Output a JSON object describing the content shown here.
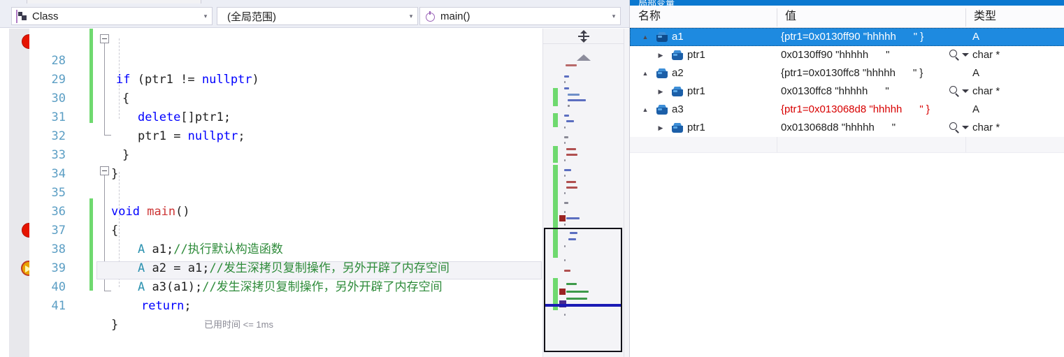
{
  "nav": {
    "class_combo": {
      "icon": "class-icon",
      "label": "Class",
      "arrow": "▾"
    },
    "scope_combo": {
      "label": "(全局范围)",
      "arrow": "▾"
    },
    "function_combo": {
      "icon": "method-icon",
      "label": "main()",
      "arrow": "▾"
    }
  },
  "editor": {
    "lines": [
      {
        "num": "28",
        "text": "if (ptr1 != nullptr)"
      },
      {
        "num": "29",
        "text": "{"
      },
      {
        "num": "30",
        "text": "    delete[]ptr1;"
      },
      {
        "num": "31",
        "text": "    ptr1 = nullptr;"
      },
      {
        "num": "32",
        "text": "}"
      },
      {
        "num": "33",
        "text": "}"
      },
      {
        "num": "34",
        "text": ""
      },
      {
        "num": "35",
        "text": "void main()"
      },
      {
        "num": "36",
        "text": "{"
      },
      {
        "num": "37",
        "text": "A a1;//执行默认构造函数"
      },
      {
        "num": "38",
        "text": "A a2 = a1;//发生深拷贝复制操作，另外开辟了内存空间"
      },
      {
        "num": "39",
        "text": "A a3(a1);//发生深拷贝复制操作，另外开辟了内存空间"
      },
      {
        "num": "40",
        "text": "return;"
      },
      {
        "num": "41",
        "text": "}"
      }
    ],
    "timing_label": "已用时间 <= 1ms",
    "breakpoint_lines": [
      "28",
      "38"
    ],
    "current_line": "40",
    "tokens": {
      "kw_if": "if",
      "kw_nullptr": "nullptr",
      "kw_delete": "delete",
      "kw_void": "void",
      "kw_return": "return",
      "fn_main": "main",
      "type_A": "A",
      "ident_ptr1": "ptr1",
      "ident_a1": "a1",
      "ident_a2": "a2",
      "ident_a3": "a3",
      "cmt_37": "//执行默认构造函数",
      "cmt_38": "//发生深拷贝复制操作，另外开辟了内存空间",
      "cmt_39": "//发生深拷贝复制操作，另外开辟了内存空间"
    }
  },
  "minimap": {
    "split_handle": "split-view-handle",
    "scroll_up": "scroll-up-arrow"
  },
  "watch": {
    "title": "局部变量",
    "columns": [
      "名称",
      "值",
      "类型"
    ],
    "rows": [
      {
        "indent": 0,
        "expander": "▲",
        "expanded": true,
        "icon": "object-cube-icon",
        "name": "a1",
        "value": "{ptr1=0x0130ff90 \"hhhhh      \" }",
        "type": "A",
        "error": false,
        "selected": true,
        "magnifier": false
      },
      {
        "indent": 1,
        "expander": "▶",
        "expanded": false,
        "icon": "object-cube-icon",
        "name": "ptr1",
        "value": "0x0130ff90 \"hhhhh      \"",
        "type": "char *",
        "error": false,
        "selected": false,
        "magnifier": true
      },
      {
        "indent": 0,
        "expander": "▲",
        "expanded": true,
        "icon": "object-cube-icon",
        "name": "a2",
        "value": "{ptr1=0x0130ffc8 \"hhhhh      \" }",
        "type": "A",
        "error": false,
        "selected": false,
        "magnifier": false
      },
      {
        "indent": 1,
        "expander": "▶",
        "expanded": false,
        "icon": "object-cube-icon",
        "name": "ptr1",
        "value": "0x0130ffc8 \"hhhhh      \"",
        "type": "char *",
        "error": false,
        "selected": false,
        "magnifier": true
      },
      {
        "indent": 0,
        "expander": "▲",
        "expanded": true,
        "icon": "object-cube-icon",
        "name": "a3",
        "value": "{ptr1=0x013068d8 \"hhhhh      \" }",
        "type": "A",
        "error": true,
        "selected": false,
        "magnifier": false
      },
      {
        "indent": 1,
        "expander": "▶",
        "expanded": false,
        "icon": "object-cube-icon",
        "name": "ptr1",
        "value": "0x013068d8 \"hhhhh      \"",
        "type": "char *",
        "error": false,
        "selected": false,
        "magnifier": true
      }
    ]
  },
  "colors": {
    "selection_blue": "#1e8ae0",
    "error_red": "#d80000",
    "keyword_blue": "#0000ff",
    "type_teal": "#2b91af",
    "comment_green": "#2e8b3a",
    "function_red": "#cc3333",
    "change_bar_green": "#6fd96f",
    "breakpoint_red": "#e51400",
    "linenumber_blue": "#5b9ec4"
  }
}
